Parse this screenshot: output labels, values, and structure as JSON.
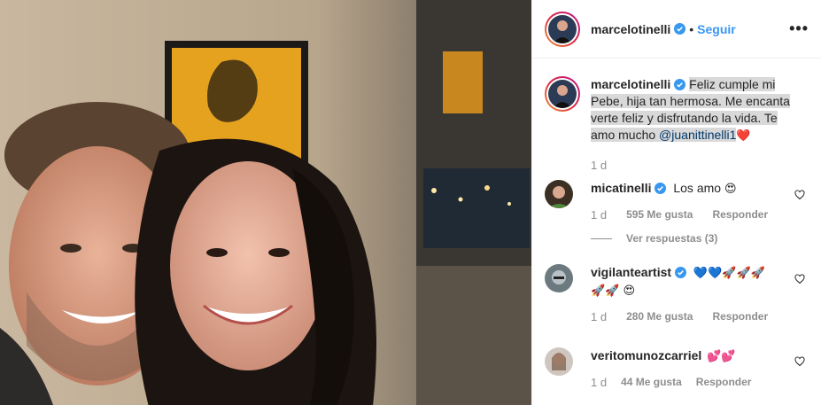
{
  "post": {
    "username": "marcelotinelli",
    "follow_label": "Seguir",
    "dot": "•",
    "more": "•••",
    "caption_text": "Feliz cumple mi Pebe, hija tan hermosa. Me encanta verte feliz y disfrutando la vida. Te amo mucho ",
    "caption_mention": "@juanittinelli1",
    "caption_emoji": "❤️",
    "age": "1 d"
  },
  "comments": [
    {
      "username": "micatinelli",
      "text": "Los amo ",
      "emoji": "😍",
      "age": "1 d",
      "likes": "595 Me gusta",
      "reply": "Responder",
      "view_replies": "Ver respuestas (3)"
    },
    {
      "username": "vigilanteartist",
      "text": "💙💙🚀🚀🚀🚀🚀 😍",
      "age": "1 d",
      "likes": "280 Me gusta",
      "reply": "Responder"
    },
    {
      "username": "veritomunozcarriel",
      "text": "💕💕",
      "age": "1 d",
      "likes": "44 Me gusta",
      "reply": "Responder"
    }
  ],
  "colors": {
    "link": "#3897f0",
    "mention": "#00376b",
    "muted": "#8e8e8e",
    "highlight": "#d9d9d9"
  },
  "icons": [
    "verified-badge-icon",
    "more-options-icon",
    "heart-outline-icon"
  ]
}
